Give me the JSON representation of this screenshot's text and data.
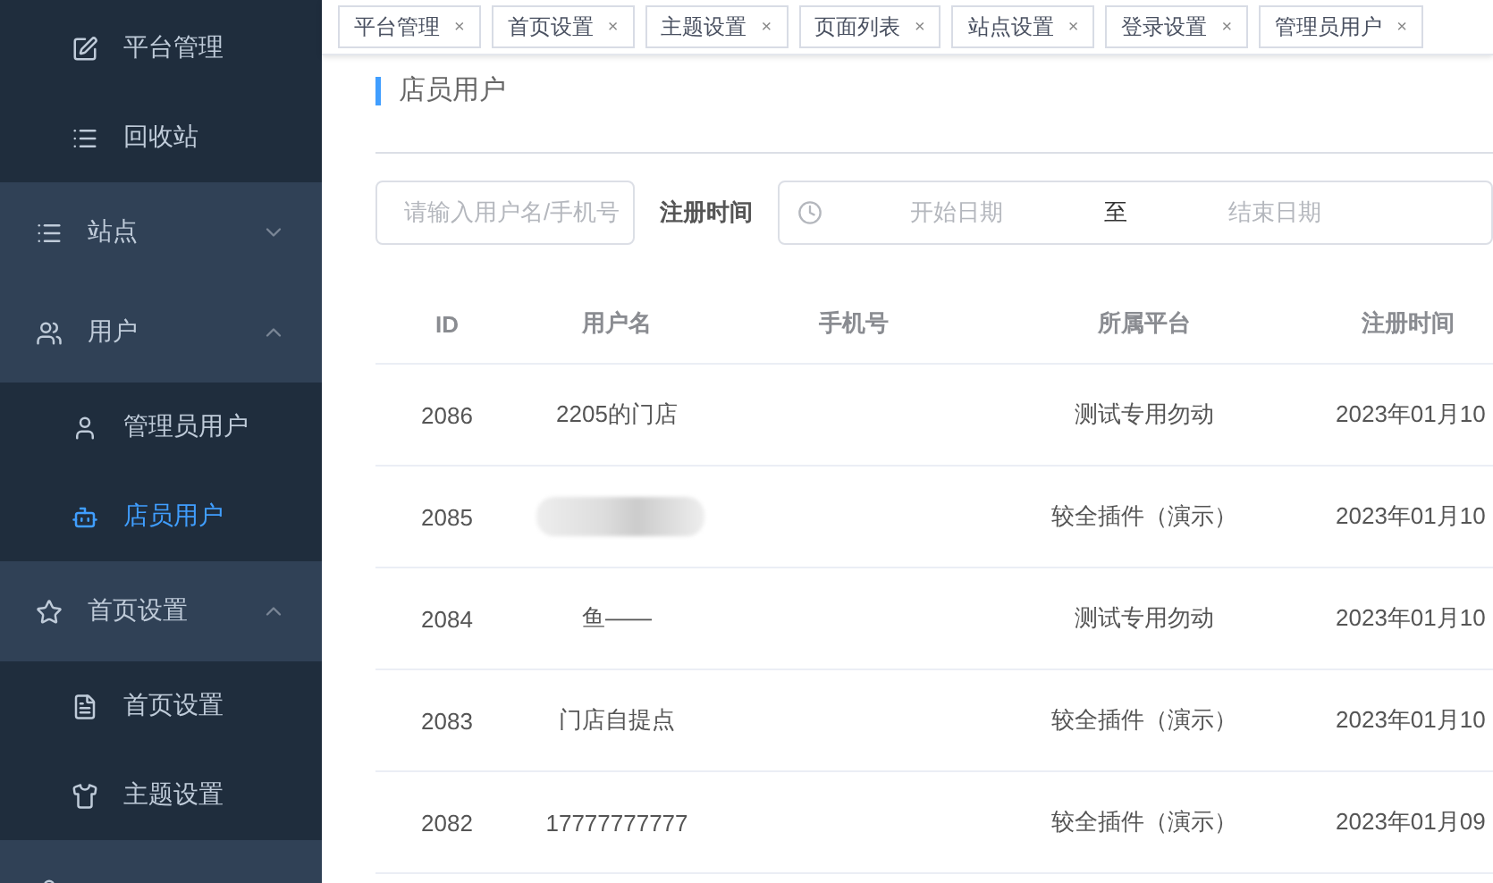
{
  "sidebar": {
    "items": [
      {
        "kind": "sub",
        "label": "平台管理",
        "selected": false
      },
      {
        "kind": "sub",
        "label": "回收站",
        "selected": false
      },
      {
        "kind": "group",
        "label": "站点",
        "expanded": false
      },
      {
        "kind": "group",
        "label": "用户",
        "expanded": true
      },
      {
        "kind": "sub",
        "label": "管理员用户",
        "selected": false
      },
      {
        "kind": "sub",
        "label": "店员用户",
        "selected": true
      },
      {
        "kind": "group",
        "label": "首页设置",
        "expanded": true
      },
      {
        "kind": "sub",
        "label": "首页设置",
        "selected": false
      },
      {
        "kind": "sub",
        "label": "主题设置",
        "selected": false
      },
      {
        "kind": "group_cut"
      }
    ]
  },
  "tabs": [
    {
      "label": "平台管理",
      "close": "×",
      "selected": false
    },
    {
      "label": "首页设置",
      "close": "×",
      "selected": false
    },
    {
      "label": "主题设置",
      "close": "×",
      "selected": false
    },
    {
      "label": "页面列表",
      "close": "×",
      "selected": false
    },
    {
      "label": "站点设置",
      "close": "×",
      "selected": false
    },
    {
      "label": "登录设置",
      "close": "×",
      "selected": false
    },
    {
      "label": "管理员用户",
      "close": "×",
      "selected": false
    }
  ],
  "page_title": "店员用户",
  "filters": {
    "search": {
      "placeholder": "请输入用户名/手机号"
    },
    "date_label": "注册时间",
    "start": {
      "placeholder": "开始日期"
    },
    "separator": "至",
    "end": {
      "placeholder": "结束日期"
    }
  },
  "table": {
    "columns": [
      "ID",
      "用户名",
      "手机号",
      "所属平台",
      "注册时间"
    ],
    "rows": [
      {
        "id": "2086",
        "username": "2205的门店",
        "redacted": false,
        "platform": "测试专用勿动",
        "registered": "2023年01月10"
      },
      {
        "id": "2085",
        "username": "",
        "redacted": true,
        "platform": "较全插件（演示）",
        "registered": "2023年01月10"
      },
      {
        "id": "2084",
        "username": "鱼——",
        "redacted": false,
        "platform": "测试专用勿动",
        "registered": "2023年01月10"
      },
      {
        "id": "2083",
        "username": "门店自提点",
        "redacted": false,
        "platform": "较全插件（演示）",
        "registered": "2023年01月10"
      },
      {
        "id": "2082",
        "username": "17777777777",
        "redacted": false,
        "platform": "较全插件（演示）",
        "registered": "2023年01月09"
      }
    ]
  }
}
